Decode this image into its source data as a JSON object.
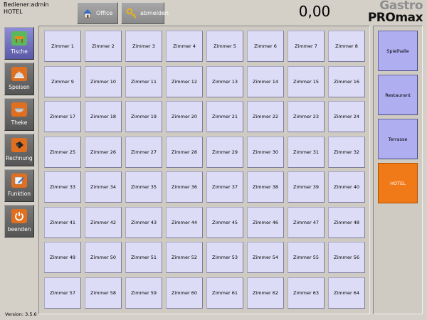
{
  "header": {
    "user_line": "Bediener:admin",
    "location_line": "HOTEL",
    "office_label": "Office",
    "logout_label": "abmelden",
    "total": "0,00",
    "logo_line1": "Gastro",
    "logo_line2": "PROmax"
  },
  "sidebar": {
    "items": [
      {
        "label": "Tische",
        "icon": "tables-icon"
      },
      {
        "label": "Speisen",
        "icon": "cloche-icon"
      },
      {
        "label": "Theke",
        "icon": "bowl-icon"
      },
      {
        "label": "Rechnung",
        "icon": "cash-register-icon"
      },
      {
        "label": "Funktion",
        "icon": "edit-icon"
      },
      {
        "label": "beenden",
        "icon": "power-icon"
      }
    ],
    "version": "Version: 3.5.6"
  },
  "rooms": [
    "Zimmer 1",
    "Zimmer 2",
    "Zimmer 3",
    "Zimmer 4",
    "Zimmer 5",
    "Zimmer 6",
    "Zimmer 7",
    "Zimmer 8",
    "Zimmer 9",
    "Zimmer 10",
    "Zimmer 11",
    "Zimmer 12",
    "Zimmer 13",
    "Zimmer 14",
    "Zimmer 15",
    "Zimmer 16",
    "Zimmer 17",
    "Zimmer 18",
    "Zimmer 19",
    "Zimmer 20",
    "Zimmer 21",
    "Zimmer 22",
    "Zimmer 23",
    "Zimmer 24",
    "Zimmer 25",
    "Zimmer 26",
    "Zimmer 27",
    "Zimmer 28",
    "Zimmer 29",
    "Zimmer 30",
    "Zimmer 31",
    "Zimmer 32",
    "Zimmer 33",
    "Zimmer 34",
    "Zimmer 35",
    "Zimmer 36",
    "Zimmer 37",
    "Zimmer 38",
    "Zimmer 39",
    "Zimmer 40",
    "Zimmer 41",
    "Zimmer 42",
    "Zimmer 43",
    "Zimmer 44",
    "Zimmer 45",
    "Zimmer 46",
    "Zimmer 47",
    "Zimmer 48",
    "Zimmer 49",
    "Zimmer 50",
    "Zimmer 51",
    "Zimmer 52",
    "Zimmer 53",
    "Zimmer 54",
    "Zimmer 55",
    "Zimmer 56",
    "Zimmer 57",
    "Zimmer 58",
    "Zimmer 59",
    "Zimmer 60",
    "Zimmer 61",
    "Zimmer 62",
    "Zimmer 63",
    "Zimmer 64"
  ],
  "areas": [
    {
      "label": "Spielhalle"
    },
    {
      "label": "Restaurant"
    },
    {
      "label": "Terrasse"
    },
    {
      "label": "HOTEL"
    }
  ],
  "colors": {
    "accent_active_area": "#f07a18",
    "room_button": "#dcdcf6",
    "area_button": "#aeaef0",
    "sidebar_active": "#6c6cc0"
  }
}
